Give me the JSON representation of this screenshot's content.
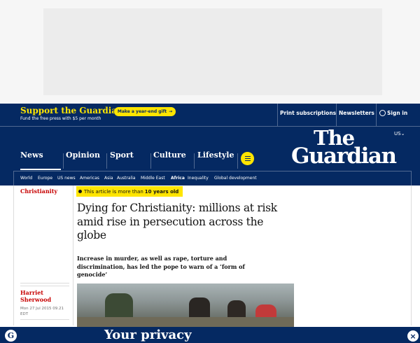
{
  "support": {
    "title": "Support the Guardian",
    "subtitle": "Fund the free press with $5 per month",
    "gift_button": "Make a year-end gift",
    "gift_arrow": "→"
  },
  "top_links": {
    "print": "Print subscriptions",
    "newsletters": "Newsletters",
    "signin": "Sign in"
  },
  "edition": "US",
  "edition_caret": "⌄",
  "logo": {
    "the": "The",
    "guardian": "Guardian"
  },
  "pillars": [
    {
      "label": "News"
    },
    {
      "label": "Opinion"
    },
    {
      "label": "Sport"
    },
    {
      "label": "Culture"
    },
    {
      "label": "Lifestyle"
    }
  ],
  "subnav": [
    {
      "label": "World"
    },
    {
      "label": "Europe"
    },
    {
      "label": "US news"
    },
    {
      "label": "Americas"
    },
    {
      "label": "Asia"
    },
    {
      "label": "Australia"
    },
    {
      "label": "Middle East"
    },
    {
      "label": "Africa"
    },
    {
      "label": "Inequality"
    },
    {
      "label": "Global development"
    }
  ],
  "article": {
    "section": "Christianity",
    "age_text": "This article is more than",
    "age_value": "10 years old",
    "headline": "Dying for Christianity: millions at risk amid rise in persecution across the globe",
    "standfirst": "Increase in murder, as well as rape, torture and discrimination, has led the pope to warn of a ‘form of genocide’",
    "author": "Harriet Sherwood",
    "dateline": "Mon 27 Jul 2015 09.21 EDT"
  },
  "privacy": {
    "title": "Your privacy",
    "logo_glyph": "G",
    "close_glyph": "×"
  }
}
